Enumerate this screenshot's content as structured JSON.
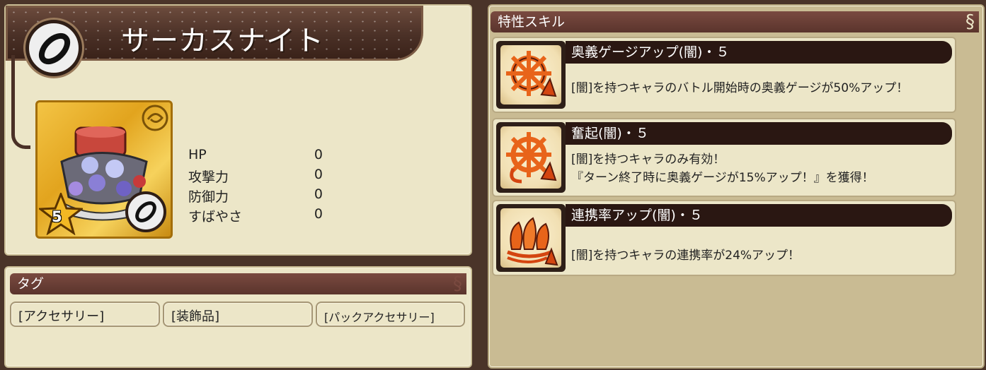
{
  "item": {
    "name": "サーカスナイト",
    "rarity": "5",
    "element_icon": "dark-ring-icon"
  },
  "stats": [
    {
      "label": "HP",
      "value": "0"
    },
    {
      "label": "攻撃力",
      "value": "0"
    },
    {
      "label": "防御力",
      "value": "0"
    },
    {
      "label": "すばやさ",
      "value": "0"
    }
  ],
  "tags": {
    "title": "タグ",
    "items": [
      "[アクセサリー]",
      "[装飾品]",
      "[パックアクセサリー]"
    ]
  },
  "skills": {
    "title": "特性スキル",
    "items": [
      {
        "name": "奥義ゲージアップ(闇)・５",
        "icon": "sun-arrow-icon",
        "lines": [
          "[闇]を持つキャラのバトル開始時の奥義ゲージが50%アップ！"
        ]
      },
      {
        "name": "奮起(闇)・５",
        "icon": "sun-arrow-curl-icon",
        "lines": [
          "[闇]を持つキャラのみ有効！",
          "『ターン終了時に奥義ゲージが15%アップ！』を獲得！"
        ]
      },
      {
        "name": "連携率アップ(闇)・５",
        "icon": "triple-flame-icon",
        "lines": [
          "[闇]を持つキャラの連携率が24%アップ！"
        ]
      }
    ]
  },
  "colors": {
    "panel_bg": "#ece6c8",
    "frame_brown": "#4a3429",
    "header_red": "#7a4a40",
    "skill_bar": "#2a1712",
    "icon_orange": "#e8641a"
  }
}
